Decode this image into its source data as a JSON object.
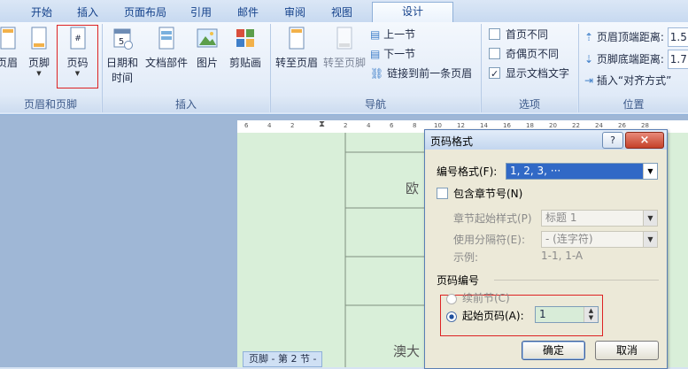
{
  "tabs": [
    "开始",
    "插入",
    "页面布局",
    "引用",
    "邮件",
    "审阅",
    "视图",
    "设计"
  ],
  "ribbon": {
    "header_footer_group": {
      "label": "页眉和页脚",
      "header_btn": "页眉",
      "footer_btn": "页脚",
      "pagenum_btn": "页码"
    },
    "insert_group": {
      "label": "插入",
      "datetime_btn": [
        "日期和",
        "时间"
      ],
      "docparts_btn": "文档部件",
      "picture_btn": "图片",
      "clipart_btn": "剪贴画"
    },
    "nav_group": {
      "label": "导航",
      "goto_header": "转至页眉",
      "goto_footer": "转至页脚",
      "prev_section": "上一节",
      "next_section": "下一节",
      "link_prev": "链接到前一条页眉"
    },
    "options_group": {
      "label": "选项",
      "diff_first": "首页不同",
      "diff_odd_even": "奇偶页不同",
      "show_doc_text": "显示文档文字",
      "diff_first_checked": false,
      "diff_odd_even_checked": false,
      "show_doc_text_checked": true
    },
    "position_group": {
      "label": "位置",
      "header_top": "页眉顶端距离:",
      "footer_bottom": "页脚底端距离:",
      "header_top_value": "1.5",
      "footer_bottom_value": "1.7",
      "insert_align_tab": "插入“对齐方式”"
    }
  },
  "ruler_ticks": [
    "6",
    "4",
    "2",
    "2",
    "4",
    "6",
    "8",
    "10",
    "12",
    "14",
    "16",
    "18",
    "20",
    "22",
    "24",
    "26",
    "28"
  ],
  "document": {
    "texts": [
      "欧",
      "澳大"
    ],
    "footer_tag": "页脚 - 第 2 节 -"
  },
  "dialog": {
    "title": "页码格式",
    "help": "?",
    "close": "×",
    "number_format_label": "编号格式(F):",
    "number_format_value": "1, 2, 3, ···",
    "include_chapter": "包含章节号(N)",
    "chapter_style_label": "章节起始样式(P)",
    "chapter_style_value": "标题 1",
    "separator_label": "使用分隔符(E):",
    "separator_value": "-  (连字符)",
    "example_label": "示例:",
    "example_value": "1-1, 1-A",
    "page_numbering_label": "页码编号",
    "continue_prev": "续前节(C)",
    "start_at": "起始页码(A):",
    "start_at_value": "1",
    "ok": "确定",
    "cancel": "取消"
  }
}
